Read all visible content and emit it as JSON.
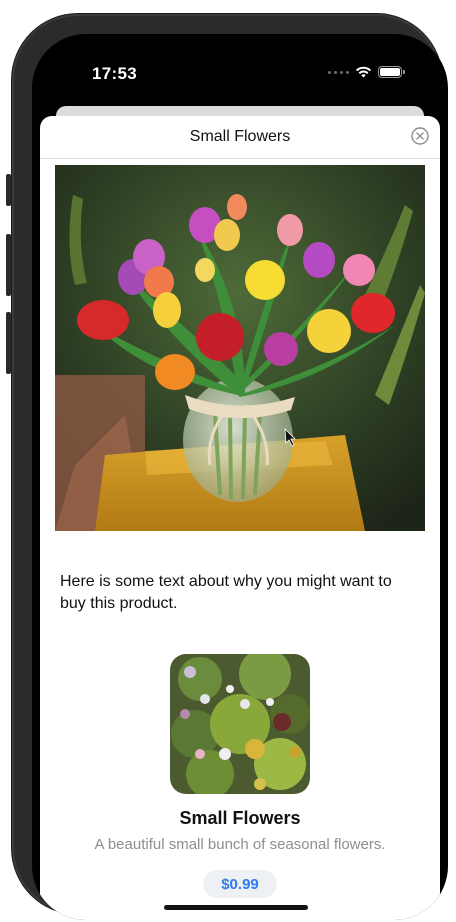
{
  "status_bar": {
    "time": "17:53"
  },
  "sheet": {
    "title": "Small Flowers",
    "close_icon": "xmark-circle-icon"
  },
  "hero_image": {
    "subject": "tulip-bouquet-photo"
  },
  "description": "Here is some text about why you might want to buy this product.",
  "product": {
    "thumbnail": "seasonal-flowers-photo",
    "name": "Small Flowers",
    "subtitle": "A beautiful small bunch of seasonal flowers.",
    "price": "$0.99"
  },
  "colors": {
    "accent": "#2f7cf6",
    "price_bg": "#eef0f4",
    "secondary_text": "#8e8e93"
  }
}
